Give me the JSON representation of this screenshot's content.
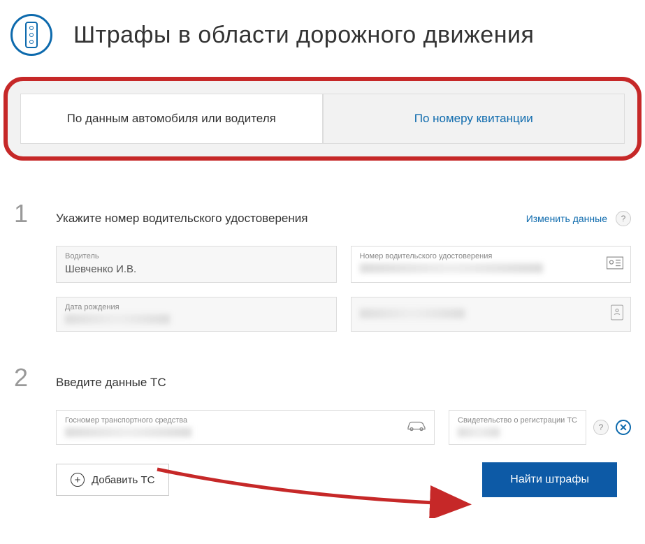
{
  "header": {
    "title": "Штрафы в области дорожного движения"
  },
  "tabs": {
    "by_vehicle": "По данным автомобиля или водителя",
    "by_receipt": "По номеру квитанции"
  },
  "step1": {
    "number": "1",
    "title": "Укажите номер водительского удостоверения",
    "change_link": "Изменить данные",
    "help": "?",
    "driver_label": "Водитель",
    "driver_value": "Шевченко И.В.",
    "license_label": "Номер водительского удостоверения",
    "dob_label": "Дата рождения"
  },
  "step2": {
    "number": "2",
    "title": "Введите данные ТС",
    "plate_label": "Госномер транспортного средства",
    "cert_label": "Свидетельство о регистрации ТС",
    "help": "?"
  },
  "buttons": {
    "add_vehicle": "Добавить ТС",
    "find_fines": "Найти штрафы"
  }
}
